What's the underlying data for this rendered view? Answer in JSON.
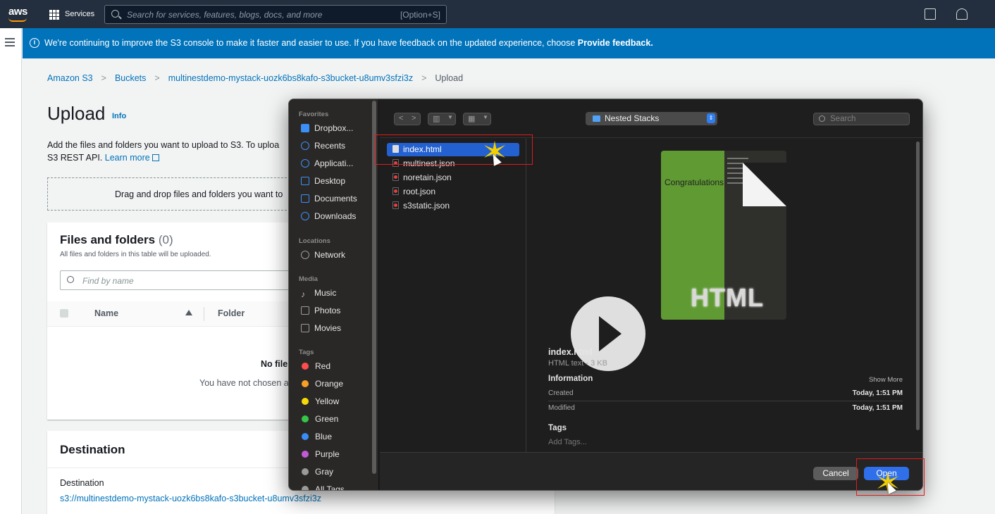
{
  "topbar": {
    "logo": "aws",
    "services_label": "Services",
    "search_placeholder": "Search for services, features, blogs, docs, and more",
    "search_shortcut": "[Option+S]",
    "icons": [
      "grid-icon",
      "search-icon",
      "cloudshell-icon",
      "bell-icon"
    ]
  },
  "banner": {
    "text": "We're continuing to improve the S3 console to make it faster and easier to use. If you have feedback on the updated experience, choose ",
    "link": "Provide feedback."
  },
  "breadcrumb": {
    "items": [
      "Amazon S3",
      "Buckets",
      "multinestdemo-mystack-uozk6bs8kafo-s3bucket-u8umv3sfzi3z",
      "Upload"
    ]
  },
  "page": {
    "title": "Upload",
    "info": "Info",
    "description": "Add the files and folders you want to upload to S3. To uploa",
    "description2": "S3 REST API. ",
    "learn_more": "Learn more",
    "dropzone": "Drag and drop files and folders you want to"
  },
  "files_folders": {
    "title": "Files and folders",
    "count": "(0)",
    "subtitle": "All files and folders in this table will be uploaded.",
    "find_placeholder": "Find by name",
    "col_name": "Name",
    "col_folder": "Folder",
    "empty_title": "No file",
    "empty_text": "You have not chosen a"
  },
  "destination": {
    "title": "Destination",
    "label": "Destination",
    "url": "s3://multinestdemo-mystack-uozk6bs8kafo-s3bucket-u8umv3sfzi3z"
  },
  "dialog": {
    "sidebar": {
      "favorites_header": "Favorites",
      "favorites": [
        "Dropbox...",
        "Recents",
        "Applicati...",
        "Desktop",
        "Documents",
        "Downloads"
      ],
      "locations_header": "Locations",
      "locations": [
        "Network"
      ],
      "media_header": "Media",
      "media": [
        "Music",
        "Photos",
        "Movies"
      ],
      "tags_header": "Tags",
      "tags": [
        {
          "label": "Red",
          "color": "#ff4d4d"
        },
        {
          "label": "Orange",
          "color": "#f7a026"
        },
        {
          "label": "Yellow",
          "color": "#f5d90a"
        },
        {
          "label": "Green",
          "color": "#35c548"
        },
        {
          "label": "Blue",
          "color": "#3a8cf5"
        },
        {
          "label": "Purple",
          "color": "#c05ad8"
        },
        {
          "label": "Gray",
          "color": "#9a9a9a"
        }
      ],
      "all_tags": "All Tags..."
    },
    "current_folder": "Nested Stacks",
    "search_placeholder": "Search",
    "files": [
      "index.html",
      "multinest.json",
      "noretain.json",
      "root.json",
      "s3static.json"
    ],
    "selected_file": "index.html",
    "preview": {
      "thumb_text": "Congratulations",
      "thumb_label": "HTML",
      "name": "index.html",
      "kind": "HTML text - 3 KB",
      "information": "Information",
      "show_more": "Show More",
      "created_label": "Created",
      "created_value": "Today, 1:51 PM",
      "modified_label": "Modified",
      "modified_value": "Today, 1:51 PM",
      "tags_label": "Tags",
      "add_tags": "Add Tags..."
    },
    "cancel": "Cancel",
    "open": "Open"
  }
}
